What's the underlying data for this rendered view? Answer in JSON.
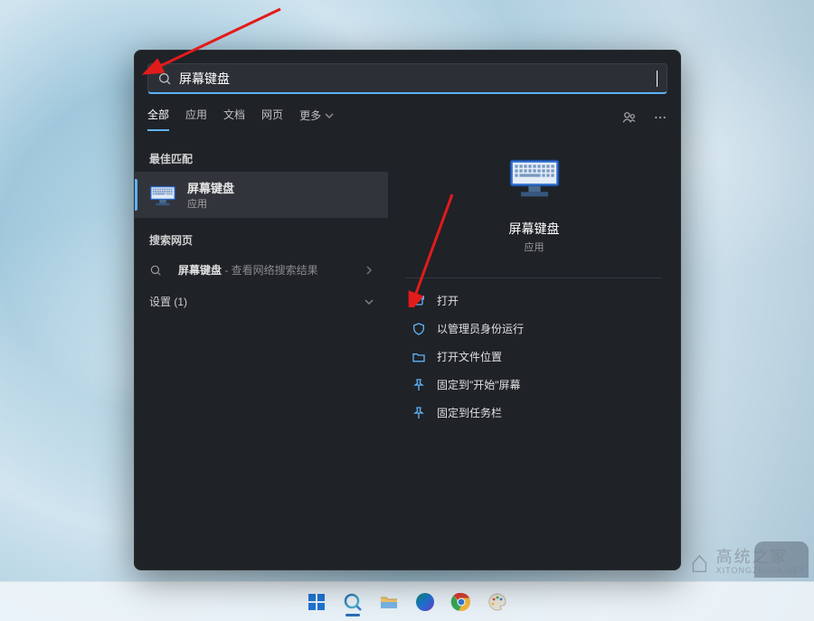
{
  "search": {
    "query": "屏幕键盘",
    "tabs": [
      "全部",
      "应用",
      "文档",
      "网页",
      "更多"
    ]
  },
  "left": {
    "best_match_label": "最佳匹配",
    "best_match": {
      "title": "屏幕键盘",
      "subtitle": "应用"
    },
    "web_section_label": "搜索网页",
    "web_result": {
      "term": "屏幕键盘",
      "suffix": " - 查看网络搜索结果"
    },
    "settings_section": {
      "label": "设置",
      "count": "(1)"
    }
  },
  "right": {
    "app_name": "屏幕键盘",
    "app_type": "应用",
    "actions": {
      "open": "打开",
      "run_admin": "以管理员身份运行",
      "open_location": "打开文件位置",
      "pin_start": "固定到\"开始\"屏幕",
      "pin_taskbar": "固定到任务栏"
    }
  },
  "watermark": {
    "zh": "高统之家",
    "en": "XITONGZHIJIA.NET"
  }
}
